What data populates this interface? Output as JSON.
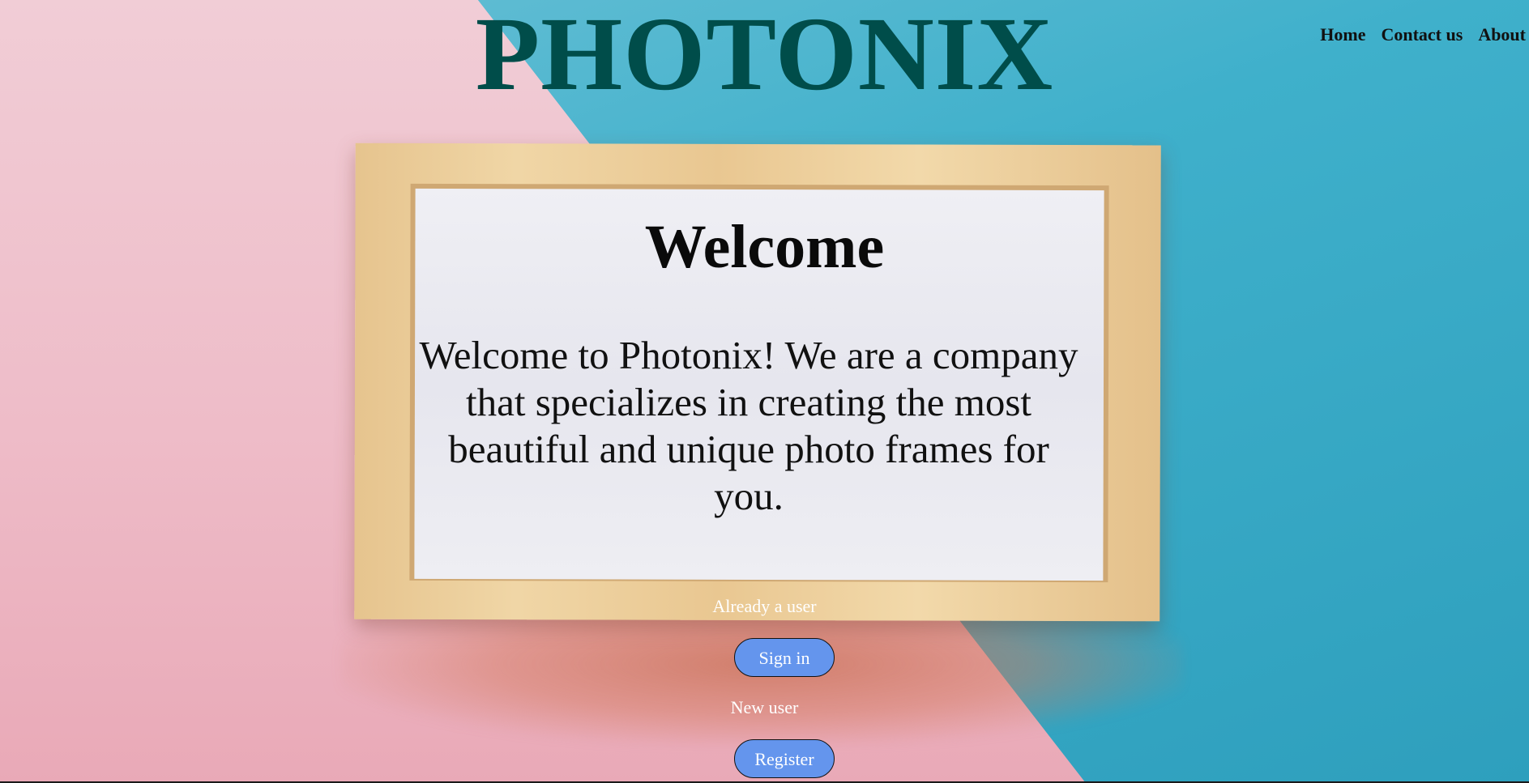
{
  "header": {
    "brand": "PHOTONIX",
    "brand_color": "#004d4a",
    "nav": [
      {
        "label": "Home"
      },
      {
        "label": "Contact us"
      },
      {
        "label": "About"
      }
    ]
  },
  "main": {
    "title": "Welcome",
    "intro": "Welcome to Photonix! We are a company that specializes in creating the most beautiful and unique photo frames for you."
  },
  "auth": {
    "existing_label": "Already a user",
    "signin_label": "Sign in",
    "new_label": "New user",
    "register_label": "Register",
    "button_color": "#6495ed"
  },
  "background": {
    "left_color": "#f1cdd6",
    "right_color": "#3fb0cb",
    "frame_color": "#ecd09c"
  }
}
